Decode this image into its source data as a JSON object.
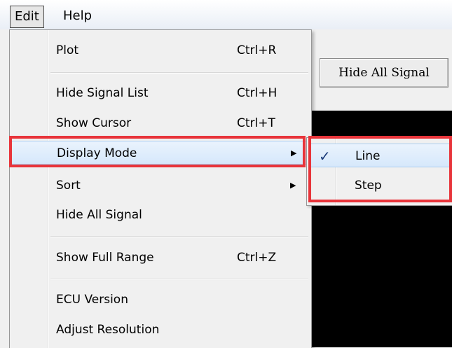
{
  "menubar": {
    "items": [
      {
        "label": "Edit"
      },
      {
        "label": "Help"
      }
    ]
  },
  "toolbar": {
    "hide_all_signal_button": "Hide All Signal"
  },
  "edit_menu": {
    "items": [
      {
        "label": "Plot",
        "shortcut": "Ctrl+R"
      },
      {
        "label": "Hide Signal List",
        "shortcut": "Ctrl+H"
      },
      {
        "label": "Show Cursor",
        "shortcut": "Ctrl+T"
      },
      {
        "label": "Display Mode",
        "has_submenu": true
      },
      {
        "label": "Sort",
        "has_submenu": true
      },
      {
        "label": "Hide All Signal"
      },
      {
        "label": "Show Full Range",
        "shortcut": "Ctrl+Z"
      },
      {
        "label": "ECU Version"
      },
      {
        "label": "Adjust Resolution"
      }
    ]
  },
  "display_mode_submenu": {
    "items": [
      {
        "label": "Line",
        "checked": true,
        "check_glyph": "✓"
      },
      {
        "label": "Step",
        "checked": false
      }
    ]
  },
  "colors": {
    "highlight_box": "#e8343a",
    "plot_background": "#000000",
    "menu_hover": "#d6e8fb"
  },
  "icons": {
    "submenu_arrow": "▶",
    "checkmark": "✓"
  }
}
